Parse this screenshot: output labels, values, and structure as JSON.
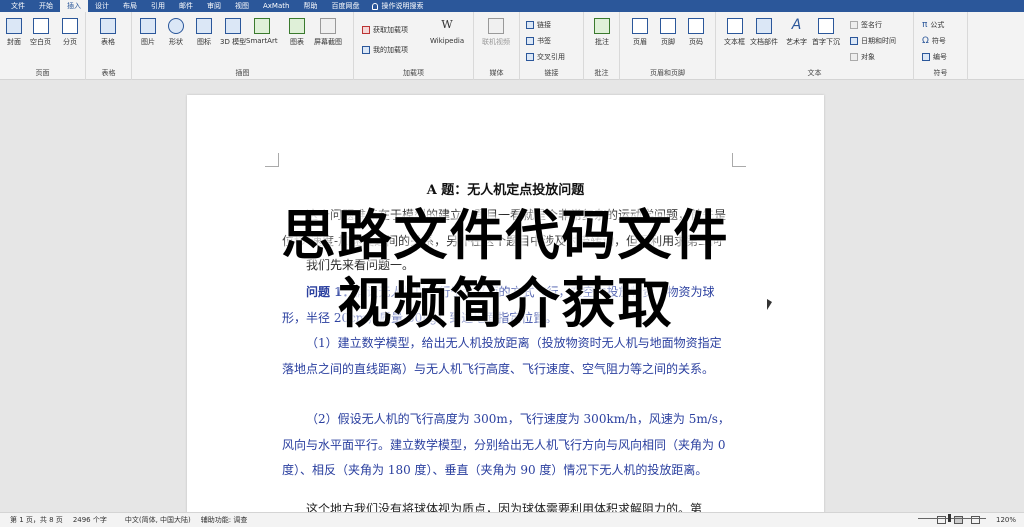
{
  "menu_tabs": [
    "文件",
    "开始",
    "插入",
    "设计",
    "布局",
    "引用",
    "邮件",
    "审阅",
    "视图",
    "AxMath",
    "帮助",
    "百度网盘"
  ],
  "tell_me": "操作说明搜索",
  "ribbon": {
    "groups": {
      "pages": {
        "label": "页面",
        "buttons": [
          "封面",
          "空白页",
          "分页"
        ]
      },
      "tables": {
        "label": "表格",
        "buttons": [
          "表格"
        ]
      },
      "illustrations": {
        "label": "插图",
        "buttons": [
          "图片",
          "形状",
          "图标",
          "3D 模型",
          "SmartArt",
          "图表",
          "屏幕截图"
        ]
      },
      "addins": {
        "label": "加载项",
        "buttons": [
          "获取加载项",
          "我的加载项",
          "Wikipedia"
        ]
      },
      "media": {
        "label": "媒体",
        "buttons": [
          "联机视频"
        ]
      },
      "links": {
        "label": "链接",
        "buttons": [
          "链接",
          "书签",
          "交叉引用"
        ]
      },
      "comments": {
        "label": "批注",
        "buttons": [
          "批注"
        ]
      },
      "header_footer": {
        "label": "页眉和页脚",
        "buttons": [
          "页眉",
          "页脚",
          "页码"
        ]
      },
      "text": {
        "label": "文本",
        "buttons": [
          "文本框",
          "文档部件",
          "艺术字",
          "首字下沉",
          "签名行",
          "日期和时间",
          "对象"
        ]
      },
      "symbols": {
        "label": "符号",
        "buttons": [
          "公式",
          "符号",
          "编号"
        ]
      }
    }
  },
  "document": {
    "title": "A 题：无人机定点投放问题",
    "p1": "这个问题难点在于模型的建立，题目一看就是个非常复杂的运动学问题，首先是位移-速度-加速度之间的关系，另外在这个题目中涉及附带转动，但是利用求第二问中的物理方程就可以解决了。",
    "p2": "我们先来看问题一。",
    "p3_label": "问题 1：",
    "p3": "假设无人机以平行于水平面的方式飞行，在空中投放物资（物资为球形，半径 20cm，质量 50kg）到达地面指定位置。",
    "p4": "（1）建立数学模型，给出无人机投放距离（投放物资时无人机与地面物资指定落地点之间的直线距离）与无人机飞行高度、飞行速度、空气阻力等之间的关系。",
    "p5": "（2）假设无人机的飞行高度为 300m，飞行速度为 300km/h，风速为 5m/s，风向与水平面平行。建立数学模型，分别给出无人机飞行方向与风向相同（夹角为 0 度）、相反（夹角为 180 度）、垂直（夹角为 90 度）情况下无人机的投放距离。",
    "p6": "这个地方我们没有将球体视为质点，因为球体需要利用体积求解阻力的。第"
  },
  "overlay": {
    "line1": "思路文件代码文件",
    "line2": "视频简介获取"
  },
  "status": {
    "page": "第 1 页，共 8 页",
    "words": "2496 个字",
    "language": "中文(简体, 中国大陆)",
    "accessibility": "辅助功能: 调查",
    "zoom": "120%"
  },
  "colors": {
    "accent": "#2b579a",
    "doc_blue": "#2a3f9f"
  }
}
